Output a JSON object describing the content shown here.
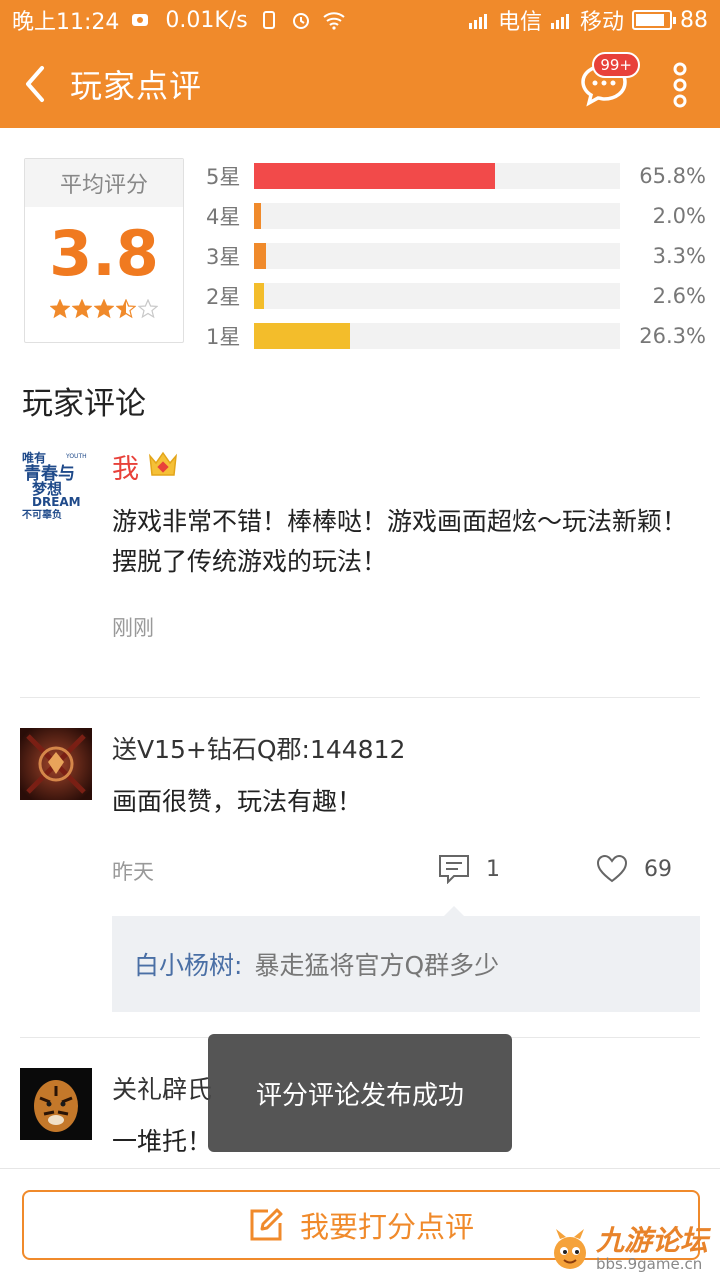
{
  "status_bar": {
    "time": "晚上11:24",
    "speed": "0.01K/s",
    "carrier1": "电信",
    "carrier2": "移动",
    "battery": "88",
    "battery_level": 0.88
  },
  "header": {
    "title": "玩家点评",
    "badge": "99+",
    "icons": [
      "chevron-left-icon",
      "chat-bubble-icon",
      "more-vertical-icon"
    ]
  },
  "rating": {
    "avg_label": "平均评分",
    "avg_score": "3.8",
    "stars_value": 3.5,
    "distribution": [
      {
        "label": "5星",
        "percent_text": "65.8%",
        "value": 65.8,
        "color": "#f24a4a"
      },
      {
        "label": "4星",
        "percent_text": "2.0%",
        "value": 2.0,
        "color": "#f08a2b"
      },
      {
        "label": "3星",
        "percent_text": "3.3%",
        "value": 3.3,
        "color": "#f08a2b"
      },
      {
        "label": "2星",
        "percent_text": "2.6%",
        "value": 2.6,
        "color": "#f3bd2b"
      },
      {
        "label": "1星",
        "percent_text": "26.3%",
        "value": 26.3,
        "color": "#f3bd2b"
      }
    ]
  },
  "section_title": "玩家评论",
  "comments": [
    {
      "name": "我",
      "text": "游戏非常不错！棒棒哒！游戏画面超炫～玩法新颖！摆脱了传统游戏的玩法！",
      "time": "刚刚",
      "avatar_logo_text": "唯有青春与梦想不可辜负 DREAM"
    },
    {
      "name": "送V15+钻石Q郡:144812",
      "text": "画面很赞，玩法有趣！",
      "time": "昨天",
      "reply_count": "1",
      "like_count": "69",
      "reply": {
        "user": "白小杨树:",
        "text": "暴走猛将官方Q群多少"
      }
    },
    {
      "name": "关礼辟氏",
      "text": "一堆托！"
    }
  ],
  "toast": "评分评论发布成功",
  "bottom": {
    "button_label": "我要打分点评",
    "watermark_title": "九游论坛",
    "watermark_url": "bbs.9game.cn"
  },
  "colors": {
    "accent": "#f08a2b",
    "score": "#f07a20"
  }
}
